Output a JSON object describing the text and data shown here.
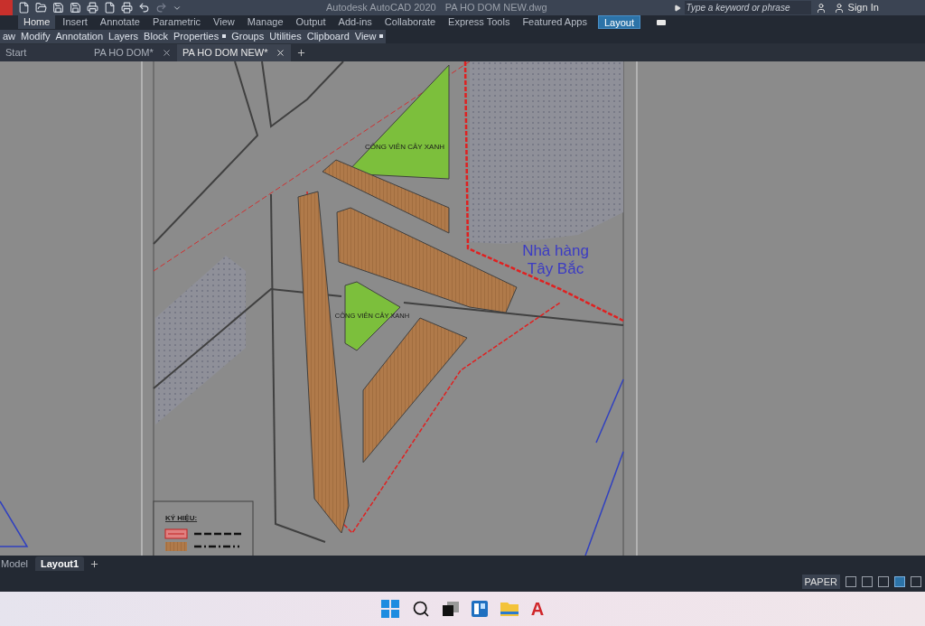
{
  "title_bar": {
    "app_title": "Autodesk AutoCAD 2020",
    "file_name": "PA HO DOM NEW.dwg",
    "search": {
      "placeholder": "Type a keyword or phrase"
    },
    "sign_in": "Sign In"
  },
  "ribbon_tabs": [
    {
      "label": "Home",
      "selected": true,
      "kind": "normal"
    },
    {
      "label": "Insert",
      "selected": false,
      "kind": "normal"
    },
    {
      "label": "Annotate",
      "selected": false,
      "kind": "normal"
    },
    {
      "label": "Parametric",
      "selected": false,
      "kind": "normal"
    },
    {
      "label": "View",
      "selected": false,
      "kind": "normal"
    },
    {
      "label": "Manage",
      "selected": false,
      "kind": "normal"
    },
    {
      "label": "Output",
      "selected": false,
      "kind": "normal"
    },
    {
      "label": "Add-ins",
      "selected": false,
      "kind": "normal"
    },
    {
      "label": "Collaborate",
      "selected": false,
      "kind": "normal"
    },
    {
      "label": "Express Tools",
      "selected": false,
      "kind": "normal"
    },
    {
      "label": "Featured Apps",
      "selected": false,
      "kind": "normal"
    },
    {
      "label": "Layout",
      "selected": false,
      "kind": "contextual"
    }
  ],
  "ribbon_panels": [
    {
      "label": "aw",
      "expandable": false
    },
    {
      "label": "Modify",
      "expandable": false
    },
    {
      "label": "Annotation",
      "expandable": false
    },
    {
      "label": "Layers",
      "expandable": false
    },
    {
      "label": "Block",
      "expandable": false
    },
    {
      "label": "Properties",
      "expandable": true
    },
    {
      "label": "Groups",
      "expandable": false
    },
    {
      "label": "Utilities",
      "expandable": false
    },
    {
      "label": "Clipboard",
      "expandable": false
    },
    {
      "label": "View",
      "expandable": true
    }
  ],
  "file_tabs": [
    {
      "label": "Start",
      "selected": false,
      "closable": false
    },
    {
      "label": "PA HO DOM*",
      "selected": false,
      "closable": true
    },
    {
      "label": "PA HO DOM NEW*",
      "selected": true,
      "closable": true
    }
  ],
  "drawing": {
    "park_labels": [
      "CÔNG VIÊN CÂY XANH",
      "CÔNG VIÊN CÂY XANH"
    ],
    "restaurant_label": [
      "Nhà hàng",
      "Tây Bắc"
    ],
    "legend_title": "KÝ HIỆU:"
  },
  "layout_tabs": [
    {
      "label": "Model",
      "selected": false,
      "kind": "model"
    },
    {
      "label": "Layout1",
      "selected": true,
      "kind": "layout"
    }
  ],
  "status_bar": {
    "space": "PAPER"
  },
  "taskbar": {
    "cad_logo": "A"
  }
}
